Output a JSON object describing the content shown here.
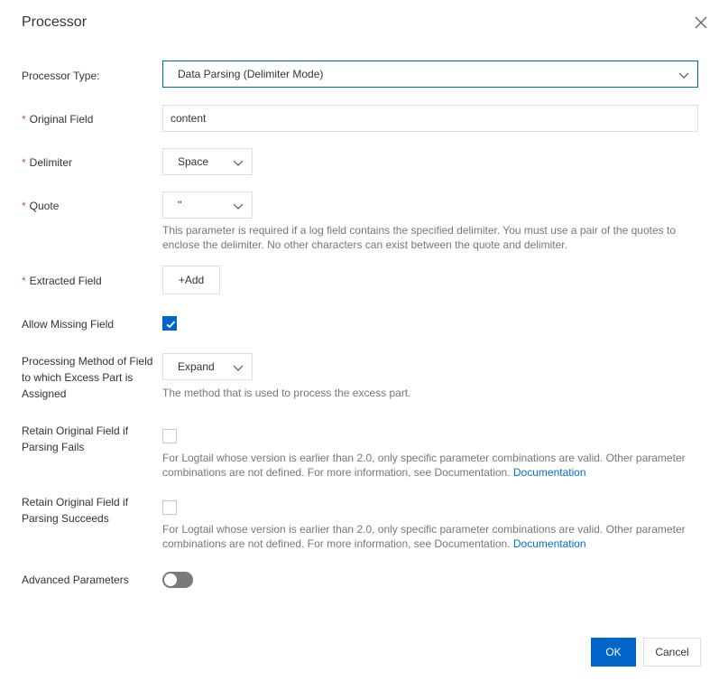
{
  "dialog": {
    "title": "Processor"
  },
  "form": {
    "processor_type": {
      "label": "Processor Type:",
      "value": "Data Parsing (Delimiter Mode)"
    },
    "original_field": {
      "label": "Original Field",
      "value": "content"
    },
    "delimiter": {
      "label": "Delimiter",
      "value": "Space"
    },
    "quote": {
      "label": "Quote",
      "value": "\"",
      "help": "This parameter is required if a log field contains the specified delimiter. You must use a pair of the quotes to enclose the delimiter. No other characters can exist between the quote and delimiter."
    },
    "extracted_field": {
      "label": "Extracted Field",
      "add_label": "+Add"
    },
    "allow_missing_field": {
      "label": "Allow Missing Field",
      "checked": true
    },
    "processing_method": {
      "label": "Processing Method of Field to which Excess Part is Assigned",
      "value": "Expand",
      "help": "The method that is used to process the excess part."
    },
    "retain_if_fails": {
      "label": "Retain Original Field if Parsing Fails",
      "checked": false,
      "help": "For Logtail whose version is earlier than 2.0, only specific parameter combinations are valid. Other parameter combinations are not defined. For more information, see Documentation.",
      "link": "Documentation"
    },
    "retain_if_succeeds": {
      "label": "Retain Original Field if Parsing Succeeds",
      "checked": false,
      "help": "For Logtail whose version is earlier than 2.0, only specific parameter combinations are valid. Other parameter combinations are not defined. For more information, see Documentation.",
      "link": "Documentation"
    },
    "advanced_parameters": {
      "label": "Advanced Parameters",
      "enabled": false
    }
  },
  "footer": {
    "ok_label": "OK",
    "cancel_label": "Cancel"
  },
  "icons": {
    "close": "close-icon",
    "chevron": "chevron-down-icon",
    "check": "check-icon"
  },
  "colors": {
    "primary": "#0064c8",
    "required": "#e84738",
    "link": "#0070cc",
    "toggle_off": "#7a7a7a"
  }
}
